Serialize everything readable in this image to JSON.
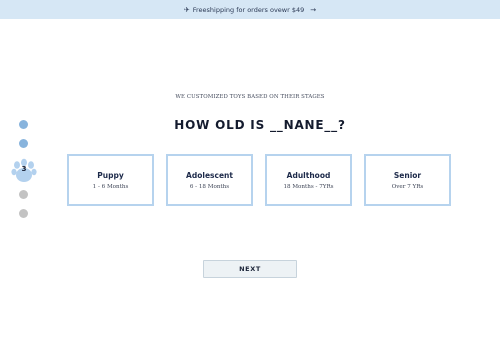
{
  "promo": {
    "icon": "airplane-icon",
    "text": "Freeshipping for orders ovewr $49",
    "arrow": "→"
  },
  "quiz": {
    "subtitle": "WE CUSTOMIZED TOYS BASED ON THEIR STAGES",
    "title": "HOW OLD IS __NANE__?"
  },
  "steps": {
    "current": "3",
    "total": 5,
    "current_index": 3,
    "active_color": "#88b4dd",
    "inactive_color": "#c3c3c3"
  },
  "options": [
    {
      "title": "Puppy",
      "range": "1 - 6 Months"
    },
    {
      "title": "Adolescent",
      "range": "6 - 18 Months"
    },
    {
      "title": "Adulthood",
      "range": "18 Months - 7YRs"
    },
    {
      "title": "Senior",
      "range": "Over 7 YRs"
    }
  ],
  "actions": {
    "next_label": "NEXT"
  }
}
